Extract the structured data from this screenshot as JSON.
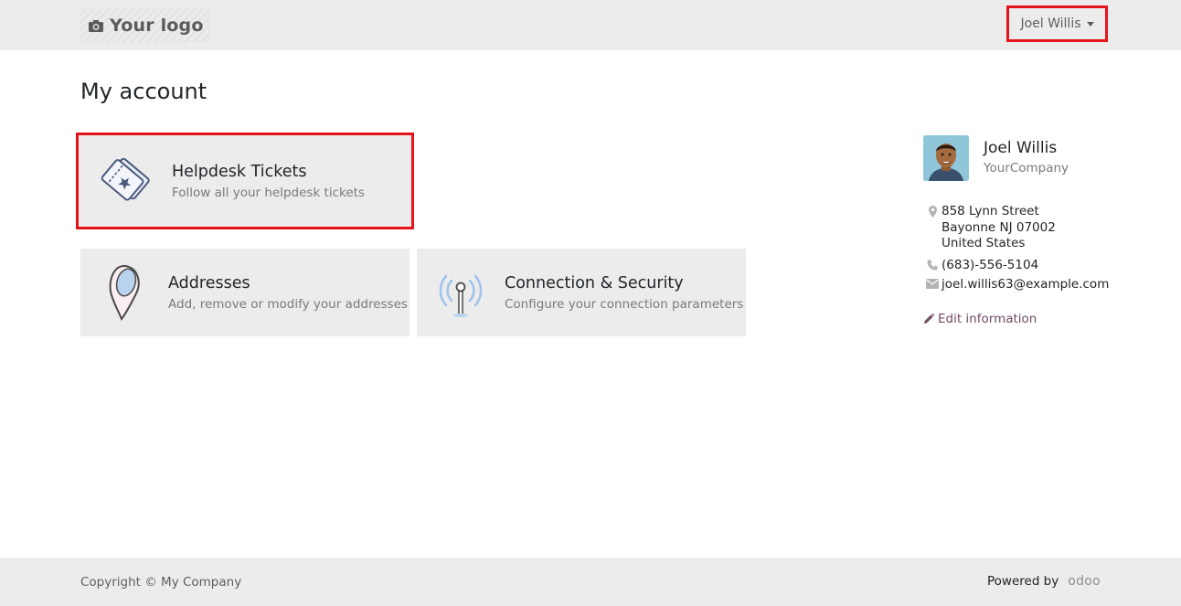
{
  "header": {
    "logo_text": "Your logo",
    "user_menu_label": "Joel Willis"
  },
  "page": {
    "title": "My account"
  },
  "cards": {
    "helpdesk": {
      "title": "Helpdesk Tickets",
      "description": "Follow all your helpdesk tickets",
      "icon": "ticket-icon"
    },
    "addresses": {
      "title": "Addresses",
      "description": "Add, remove or modify your addresses",
      "icon": "map-pin-icon"
    },
    "security": {
      "title": "Connection & Security",
      "description": "Configure your connection parameters",
      "icon": "antenna-icon"
    }
  },
  "profile": {
    "name": "Joel Willis",
    "company": "YourCompany",
    "address_lines": [
      "858 Lynn Street",
      "Bayonne NJ 07002",
      "United States"
    ],
    "phone": "(683)-556-5104",
    "email": "joel.willis63@example.com",
    "edit_label": "Edit information"
  },
  "footer": {
    "copyright": "Copyright © My Company",
    "powered_by": "Powered by",
    "brand": "odoo"
  },
  "colors": {
    "accent": "#714b67",
    "highlight_border": "#e5131b",
    "card_bg": "#ececec"
  }
}
